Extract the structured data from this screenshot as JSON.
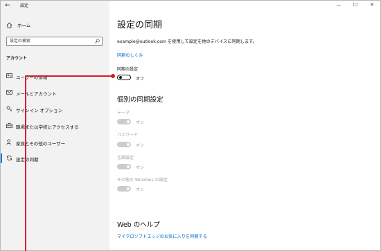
{
  "window": {
    "title": "設定",
    "back_glyph": "←",
    "controls": {
      "minimize": "—",
      "maximize": "☐",
      "close": "✕"
    }
  },
  "sidebar": {
    "home_label": "ホーム",
    "search_placeholder": "設定の検索",
    "section_heading": "アカウント",
    "items": [
      {
        "label": "ユーザーの情報",
        "icon": "user-card-icon"
      },
      {
        "label": "メールとアカウント",
        "icon": "mail-icon"
      },
      {
        "label": "サインイン オプション",
        "icon": "key-icon"
      },
      {
        "label": "職場または学校にアクセスする",
        "icon": "briefcase-icon"
      },
      {
        "label": "家族とその他のユーザー",
        "icon": "person-add-icon"
      },
      {
        "label": "設定の同期",
        "icon": "sync-icon"
      }
    ],
    "active_index": 5
  },
  "main": {
    "title": "設定の同期",
    "description": "example@outlook.com を使用して設定を他のデバイスに同期します。",
    "how_link": "同期のしくみ",
    "sync_settings": {
      "label": "同期の設定",
      "state": "オフ",
      "on": false
    },
    "individual_heading": "個別の同期設定",
    "individual": [
      {
        "label": "テーマ",
        "state": "オン"
      },
      {
        "label": "パスワード",
        "state": "オン"
      },
      {
        "label": "言語設定",
        "state": "オン"
      },
      {
        "label": "その他の Windows の設定",
        "state": "オン"
      }
    ],
    "help_heading": "Web のヘルプ",
    "help_links": [
      "マイクロソフトエッジのお気に入りを同期する"
    ]
  },
  "colors": {
    "accent": "#0078d7",
    "link": "#0067c0",
    "callout": "#d0202a",
    "sidebar_bg": "#f2f2f2"
  }
}
